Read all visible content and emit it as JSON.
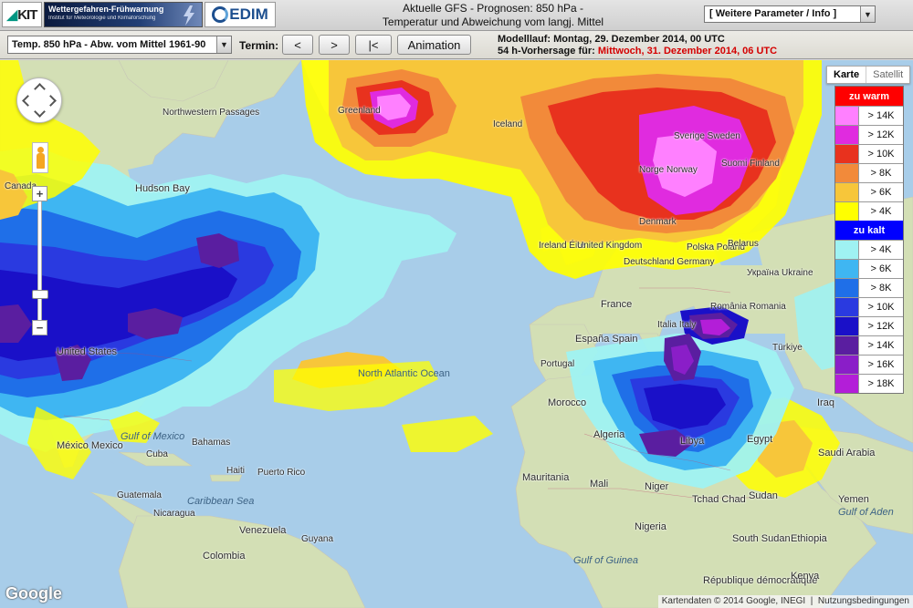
{
  "header": {
    "logo_kit": "KIT",
    "banner_title": "Wettergefahren-Frühwarnung",
    "banner_subtitle": "Institut für Meteorologie und Klimaforschung",
    "logo_cedim": "EDIM",
    "title_line1": "Aktuelle GFS - Prognosen: 850 hPa -",
    "title_line2": "Temperatur und Abweichung vom langj. Mittel",
    "param_select": "[ Weitere Parameter / Info ]"
  },
  "toolbar": {
    "field_select": "Temp. 850 hPa - Abw. vom Mittel 1961-90",
    "termin_label": "Termin:",
    "prev_label": "<",
    "next_label": ">",
    "first_label": "|<",
    "animation_label": "Animation",
    "modelllauf_label": "Modelllauf:",
    "modelllauf_value": "Montag, 29. Dezember 2014, 00 UTC",
    "forecast_label": "54 h-Vorhersage für:",
    "forecast_value": "Mittwoch, 31. Dezember 2014, 06 UTC"
  },
  "map": {
    "type_options": [
      "Karte",
      "Satellit"
    ],
    "active_type": "Karte",
    "zoom_in": "+",
    "zoom_out": "−",
    "google_logo": "Google",
    "attribution": "Kartendaten © 2014 Google, INEGI",
    "terms": "Nutzungsbedingungen",
    "place_labels": [
      "Northwestern Passages",
      "Hudson Bay",
      "Canada",
      "United States",
      "México Mexico",
      "Gulf of Mexico",
      "Cuba",
      "Puerto Rico",
      "Caribbean Sea",
      "Guatemala",
      "Nicaragua",
      "Venezuela",
      "Colombia",
      "Guyana",
      "North Atlantic Ocean",
      "Greenland",
      "Iceland",
      "Ireland Éire",
      "United Kingdom",
      "Norge Norway",
      "Sverige Sweden",
      "Suomi Finland",
      "Denmark",
      "Polska Poland",
      "Belarus",
      "Deutschland Germany",
      "France",
      "España Spain",
      "Portugal",
      "Italia Italy",
      "România Romania",
      "Україна Ukraine",
      "Türkiye",
      "Iraq",
      "Morocco",
      "Algeria",
      "Libya",
      "Egypt",
      "Saudi Arabia",
      "Mauritania",
      "Mali",
      "Niger",
      "Tchad Chad",
      "Sudan",
      "Nigeria",
      "Yemen",
      "Gulf of Aden",
      "South Sudan",
      "Ethiopia",
      "Gulf of Guinea",
      "République démocratique",
      "Kenya",
      "Bahamas",
      "Haiti"
    ]
  },
  "legend": {
    "warm_title": "zu warm",
    "cold_title": "zu kalt",
    "warm_color": "#ff0000",
    "cold_color": "#0000ff",
    "warm": [
      {
        "label": "> 14K",
        "color": "#ff80ff"
      },
      {
        "label": "> 12K",
        "color": "#e02bdf"
      },
      {
        "label": "> 10K",
        "color": "#e8321e"
      },
      {
        "label": "> 8K",
        "color": "#f28a3a"
      },
      {
        "label": "> 6K",
        "color": "#f7c63a"
      },
      {
        "label": "> 4K",
        "color": "#ffff00"
      }
    ],
    "cold": [
      {
        "label": "> 4K",
        "color": "#9ff2f2"
      },
      {
        "label": "> 6K",
        "color": "#3fb6f2"
      },
      {
        "label": "> 8K",
        "color": "#1f6fe8"
      },
      {
        "label": "> 10K",
        "color": "#2a3ae0"
      },
      {
        "label": "> 12K",
        "color": "#1a10c8"
      },
      {
        "label": "> 14K",
        "color": "#5a1ea0"
      },
      {
        "label": "> 16K",
        "color": "#8a1ec8"
      },
      {
        "label": "> 18K",
        "color": "#b31ed8"
      }
    ]
  }
}
